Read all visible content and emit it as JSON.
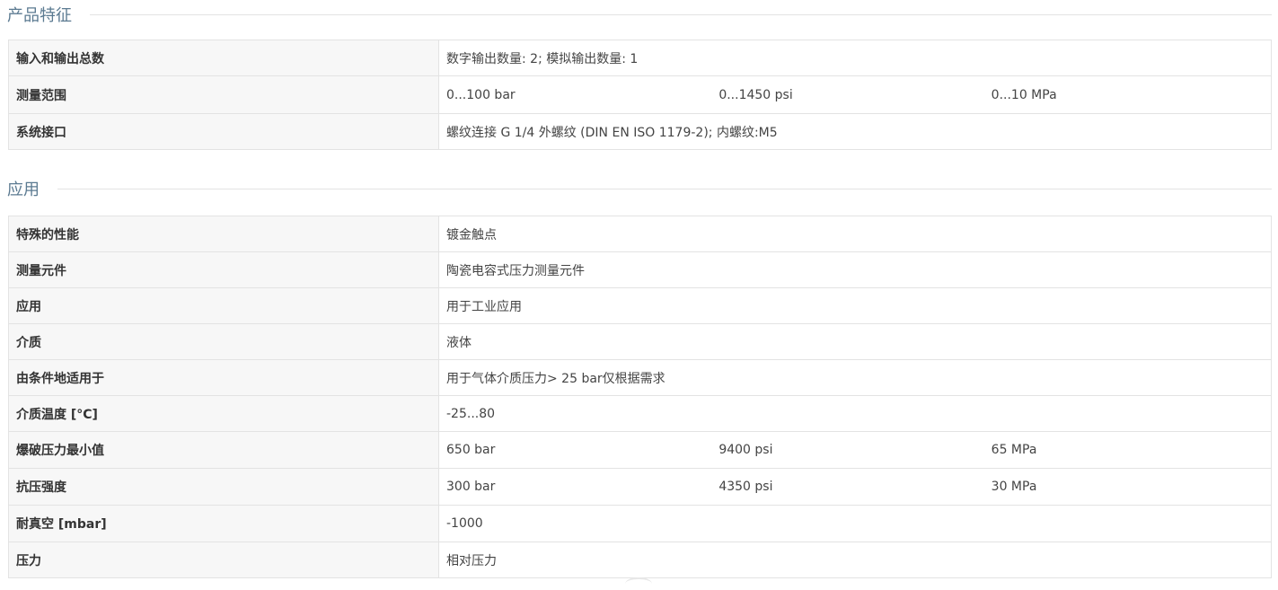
{
  "sections": [
    {
      "title": "产品特征",
      "rows": [
        {
          "label": "输入和输出总数",
          "values": [
            "数字输出数量: 2; 模拟输出数量: 1"
          ]
        },
        {
          "label": "测量范围",
          "values": [
            "0...100 bar",
            "0...1450 psi",
            "0...10 MPa"
          ]
        },
        {
          "label": "系统接口",
          "values": [
            "螺纹连接 G 1/4 外螺纹 (DIN EN ISO 1179-2); 内螺纹:M5"
          ]
        }
      ]
    },
    {
      "title": "应用",
      "rows": [
        {
          "label": "特殊的性能",
          "values": [
            "镀金触点"
          ]
        },
        {
          "label": "测量元件",
          "values": [
            "陶瓷电容式压力测量元件"
          ]
        },
        {
          "label": "应用",
          "values": [
            "用于工业应用"
          ]
        },
        {
          "label": "介质",
          "values": [
            "液体"
          ]
        },
        {
          "label": "由条件地适用于",
          "values": [
            "用于气体介质压力> 25 bar仅根据需求"
          ]
        },
        {
          "label": "介质温度 [°C]",
          "values": [
            "-25...80"
          ]
        },
        {
          "label": "爆破压力最小值",
          "values": [
            "650 bar",
            "9400 psi",
            "65 MPa"
          ]
        },
        {
          "label": "抗压强度",
          "values": [
            "300 bar",
            "4350 psi",
            "30 MPa"
          ]
        },
        {
          "label": "耐真空 [mbar]",
          "values": [
            "-1000"
          ]
        },
        {
          "label": "压力",
          "values": [
            "相对压力"
          ]
        }
      ]
    }
  ]
}
